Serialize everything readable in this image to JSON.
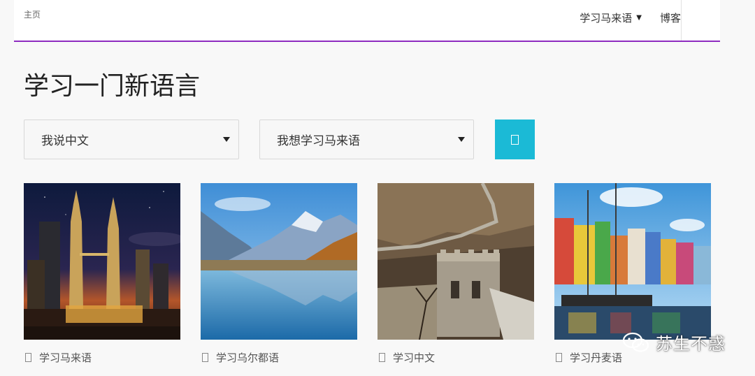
{
  "header": {
    "home_link": "主页",
    "nav": [
      {
        "label": "学习马来语",
        "has_dropdown": true
      },
      {
        "label": "博客",
        "has_dropdown": false
      }
    ],
    "accent_color": "#8e2bbf"
  },
  "main": {
    "title": "学习一门新语言",
    "speak_select": {
      "value": "我说中文"
    },
    "learn_select": {
      "value": "我想学习马来语"
    },
    "go_button_color": "#1bbad6",
    "cards": [
      {
        "caption": "学习马来语",
        "image": "petronas-towers-night-photo"
      },
      {
        "caption": "学习乌尔都语",
        "image": "mountain-lake-photo"
      },
      {
        "caption": "学习中文",
        "image": "great-wall-photo"
      },
      {
        "caption": "学习丹麦语",
        "image": "nyhavn-harbor-photo"
      }
    ]
  },
  "watermark": {
    "text": "苏生不惑",
    "icon": "wechat-icon"
  }
}
